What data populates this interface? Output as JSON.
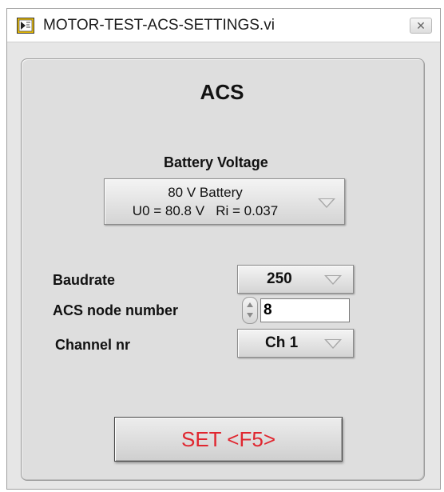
{
  "window": {
    "title": "MOTOR-TEST-ACS-SETTINGS.vi",
    "close_glyph": "✕",
    "icon": "labview-vi-icon"
  },
  "panel": {
    "title": "ACS"
  },
  "battery": {
    "label": "Battery Voltage",
    "selected_line1": "80 V Battery",
    "selected_line2": "U0 = 80.8 V   Ri = 0.037"
  },
  "baudrate": {
    "label": "Baudrate",
    "value": "250"
  },
  "node": {
    "label": "ACS node number",
    "value": "8"
  },
  "channel": {
    "label": "Channel nr",
    "value": "Ch 1"
  },
  "set_button": {
    "label": "SET <F5>"
  },
  "colors": {
    "set_label": "#e0262f",
    "icon_yellow": "#f2c200",
    "icon_border": "#333333"
  }
}
